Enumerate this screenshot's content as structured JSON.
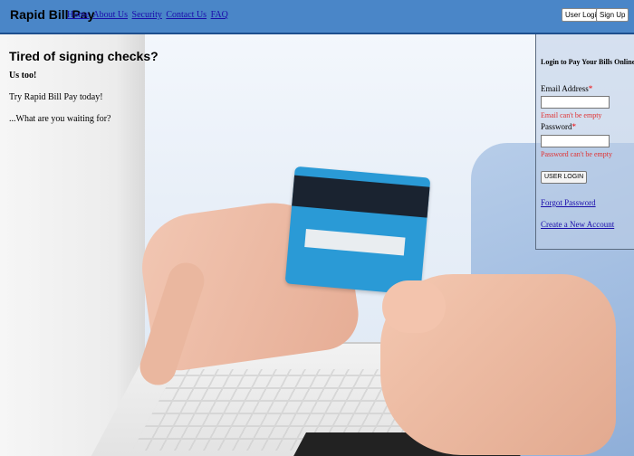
{
  "header": {
    "brand": "Rapid Bill Pay",
    "nav": [
      "Home",
      "About Us",
      "Security",
      "Contact Us",
      "FAQ"
    ],
    "login_button": "User Login",
    "signup_button": "Sign Up",
    "colors": {
      "bar": "#4a86c8",
      "border": "#1e4f8e"
    }
  },
  "hero": {
    "headline": "Tired of signing checks?",
    "subhead": "Us too!",
    "line1": "Try Rapid Bill Pay today!",
    "line2": "...What are you waiting for?",
    "image": "hands-laptop-credit-card"
  },
  "login": {
    "title": "Login to Pay Your Bills Online",
    "email_label": "Email Address",
    "email_value": "",
    "email_error": "Email can't be empty",
    "password_label": "Password",
    "password_value": "",
    "password_error": "Password can't be empty",
    "required_mark": "*",
    "submit": "USER LOGIN",
    "forgot": "Forgot Password",
    "create": "Create a New Account",
    "error_color": "#e03030"
  }
}
